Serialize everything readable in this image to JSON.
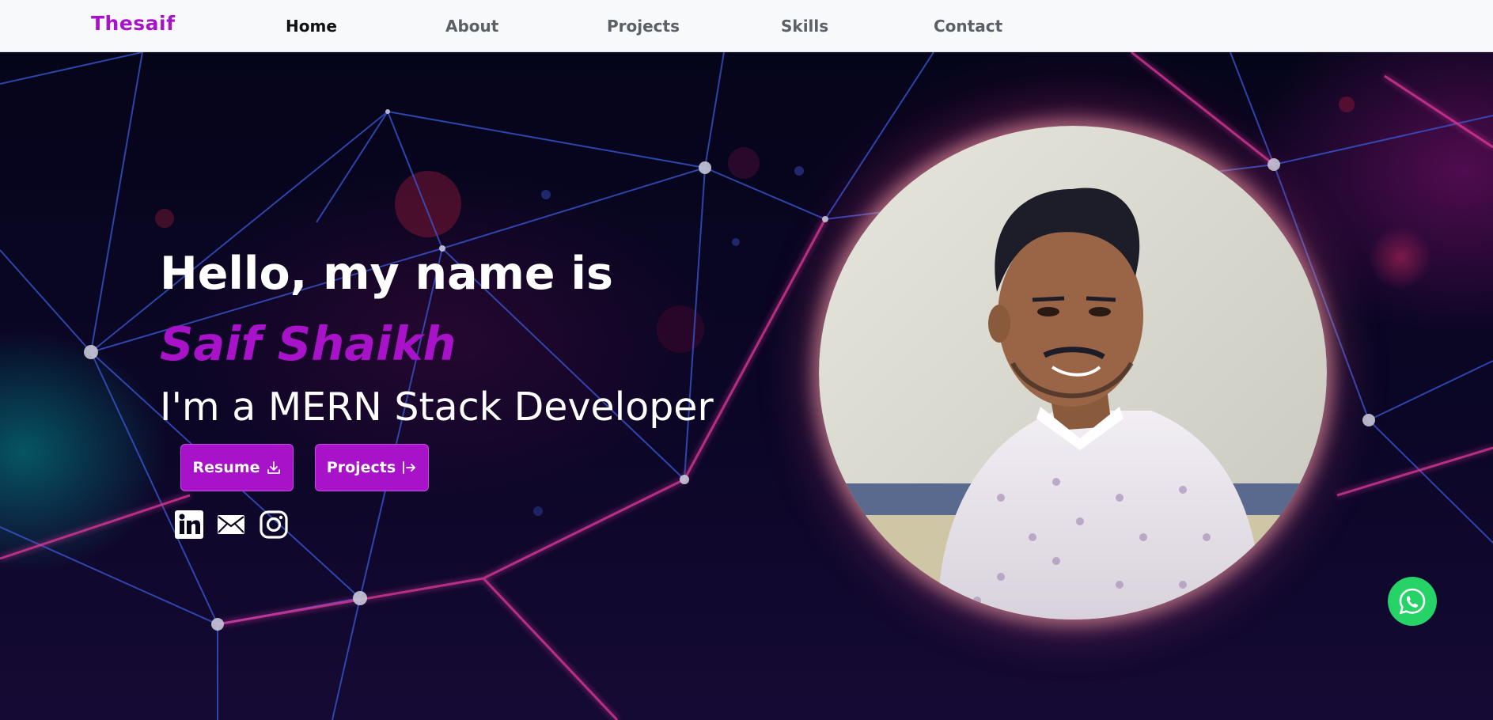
{
  "brand": {
    "name": "Thesaif",
    "color": "#a812c9"
  },
  "nav": {
    "items": [
      {
        "label": "Home",
        "active": true
      },
      {
        "label": "About",
        "active": false
      },
      {
        "label": "Projects",
        "active": false
      },
      {
        "label": "Skills",
        "active": false
      },
      {
        "label": "Contact",
        "active": false
      }
    ]
  },
  "hero": {
    "greeting": "Hello, my name is",
    "name": "Saif Shaikh",
    "role": "I'm a MERN Stack Developer",
    "buttons": {
      "resume": {
        "label": "Resume",
        "icon": "download-icon"
      },
      "projects": {
        "label": "Projects",
        "icon": "arrow-right-to-line-icon"
      }
    },
    "social": [
      {
        "name": "linkedin-icon"
      },
      {
        "name": "mail-icon"
      },
      {
        "name": "instagram-icon"
      }
    ],
    "portrait": {
      "icon": "profile-photo"
    }
  },
  "floating": {
    "whatsapp": {
      "icon": "whatsapp-icon",
      "color": "#25d366"
    }
  },
  "colors": {
    "accent": "#a812c9",
    "nav_bg": "#f8f9fa",
    "hero_bg": "#07051a"
  }
}
